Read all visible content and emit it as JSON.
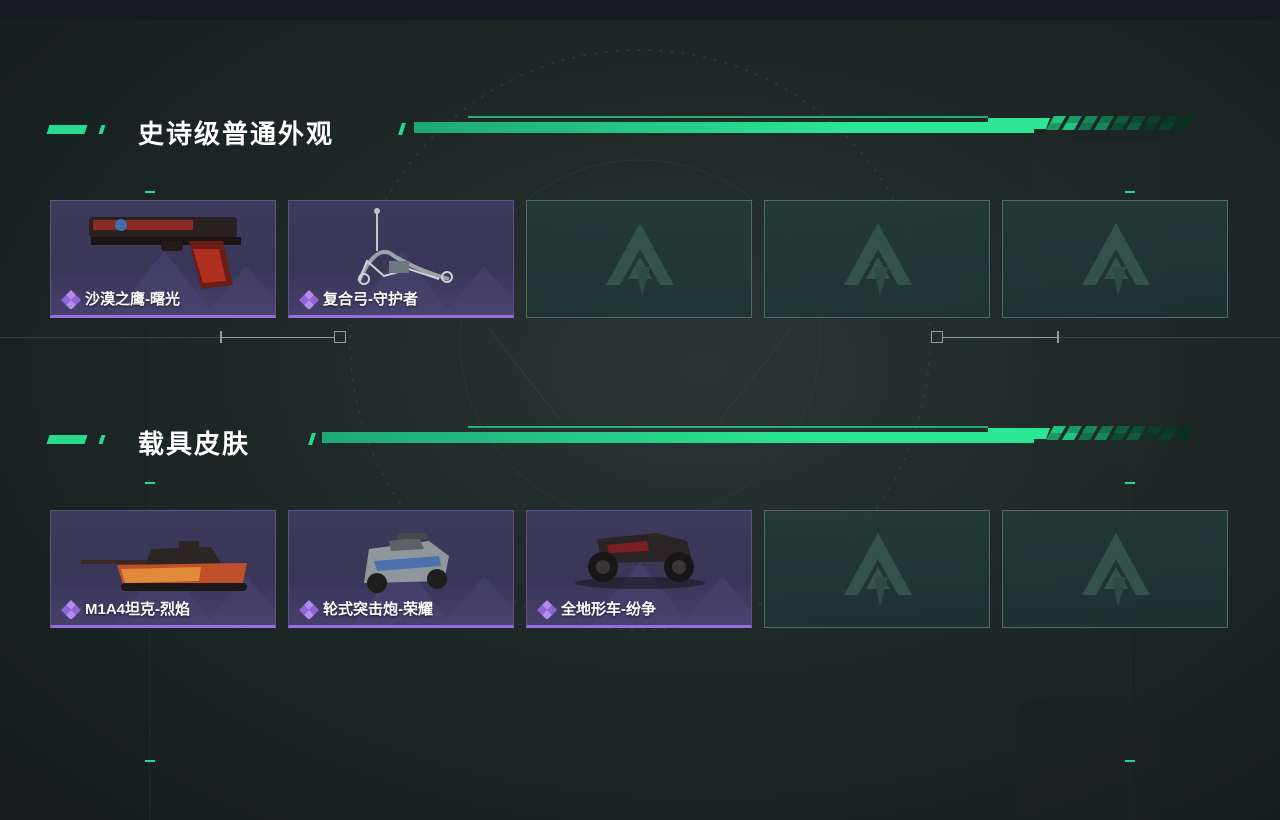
{
  "sections": [
    {
      "title": "史诗级普通外观",
      "items": [
        {
          "label": "沙漠之鹰-曙光",
          "icon": "pistol-icon",
          "filled": true
        },
        {
          "label": "复合弓-守护者",
          "icon": "bow-icon",
          "filled": true
        },
        {
          "label": "",
          "icon": "empty-slot-logo-icon",
          "filled": false
        },
        {
          "label": "",
          "icon": "empty-slot-logo-icon",
          "filled": false
        },
        {
          "label": "",
          "icon": "empty-slot-logo-icon",
          "filled": false
        }
      ]
    },
    {
      "title": "载具皮肤",
      "items": [
        {
          "label": "M1A4坦克-烈焰",
          "icon": "tank-icon",
          "filled": true
        },
        {
          "label": "轮式突击炮-荣耀",
          "icon": "armored-car-icon",
          "filled": true
        },
        {
          "label": "全地形车-纷争",
          "icon": "atv-icon",
          "filled": true
        },
        {
          "label": "",
          "icon": "empty-slot-logo-icon",
          "filled": false
        },
        {
          "label": "",
          "icon": "empty-slot-logo-icon",
          "filled": false
        }
      ]
    }
  ],
  "colors": {
    "accent_green": "#2be694",
    "epic_purple": "#9a6ce0",
    "card_purple": "#3e3a5c",
    "empty_slot": "#243e3a"
  }
}
